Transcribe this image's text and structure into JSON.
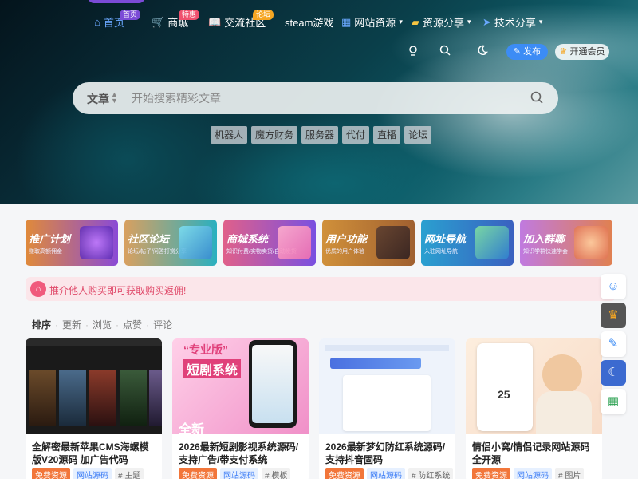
{
  "nav": {
    "items": [
      {
        "label": "首页",
        "badge": "首页"
      },
      {
        "label": "商城",
        "badge": "特惠"
      },
      {
        "label": "交流社区",
        "badge": "论坛"
      },
      {
        "label": "steam游戏"
      },
      {
        "label": "网站资源"
      },
      {
        "label": "资源分享"
      },
      {
        "label": "技术分享"
      }
    ],
    "publish": "发布",
    "vip": "开通会员"
  },
  "search": {
    "category": "文章",
    "placeholder": "开始搜索精彩文章"
  },
  "hot_tags": [
    "机器人",
    "魔方财务",
    "服务器",
    "代付",
    "直播",
    "论坛"
  ],
  "categories": [
    {
      "title": "推广计划",
      "sub": "赚取高额佣金"
    },
    {
      "title": "社区论坛",
      "sub": "论坛/帖子/问答打赏分享"
    },
    {
      "title": "商城系统",
      "sub": "知识付费/实物卖货/自动发货"
    },
    {
      "title": "用户功能",
      "sub": "优质的用户体验"
    },
    {
      "title": "网址导航",
      "sub": "入驻网址导航"
    },
    {
      "title": "加入群聊",
      "sub": "知识学群快速学会"
    }
  ],
  "notice": "推介他人购买即可获取购买返佣!",
  "sort": {
    "label": "排序",
    "options": [
      "更新",
      "浏览",
      "点赞",
      "评论"
    ]
  },
  "posts": [
    {
      "title": "全解密最新苹果CMS海螺模版V20源码 加广告代码",
      "tags": [
        "免费资源",
        "网站源码",
        "# 主题"
      ]
    },
    {
      "title": "2026最新短剧影视系统源码/支持广告/带支付系统",
      "tags": [
        "免费资源",
        "网站源码",
        "# 模板"
      ],
      "img_text": [
        "“专业版”",
        "短剧系统",
        "全新"
      ]
    },
    {
      "title": "2026最新梦幻防红系统源码/支持抖音固码",
      "tags": [
        "免费资源",
        "网站源码",
        "# 防红系统"
      ]
    },
    {
      "title": "情侣小窝/情侣记录网站源码 全开源",
      "tags": [
        "免费资源",
        "网站源码",
        "# 图片"
      ],
      "img_text": [
        "25"
      ]
    }
  ],
  "colors": {
    "accent": "#3c8cf5",
    "notice_bg": "#fbe6ea",
    "notice_text": "#e04a6a",
    "free_tag": "#f2763a"
  }
}
